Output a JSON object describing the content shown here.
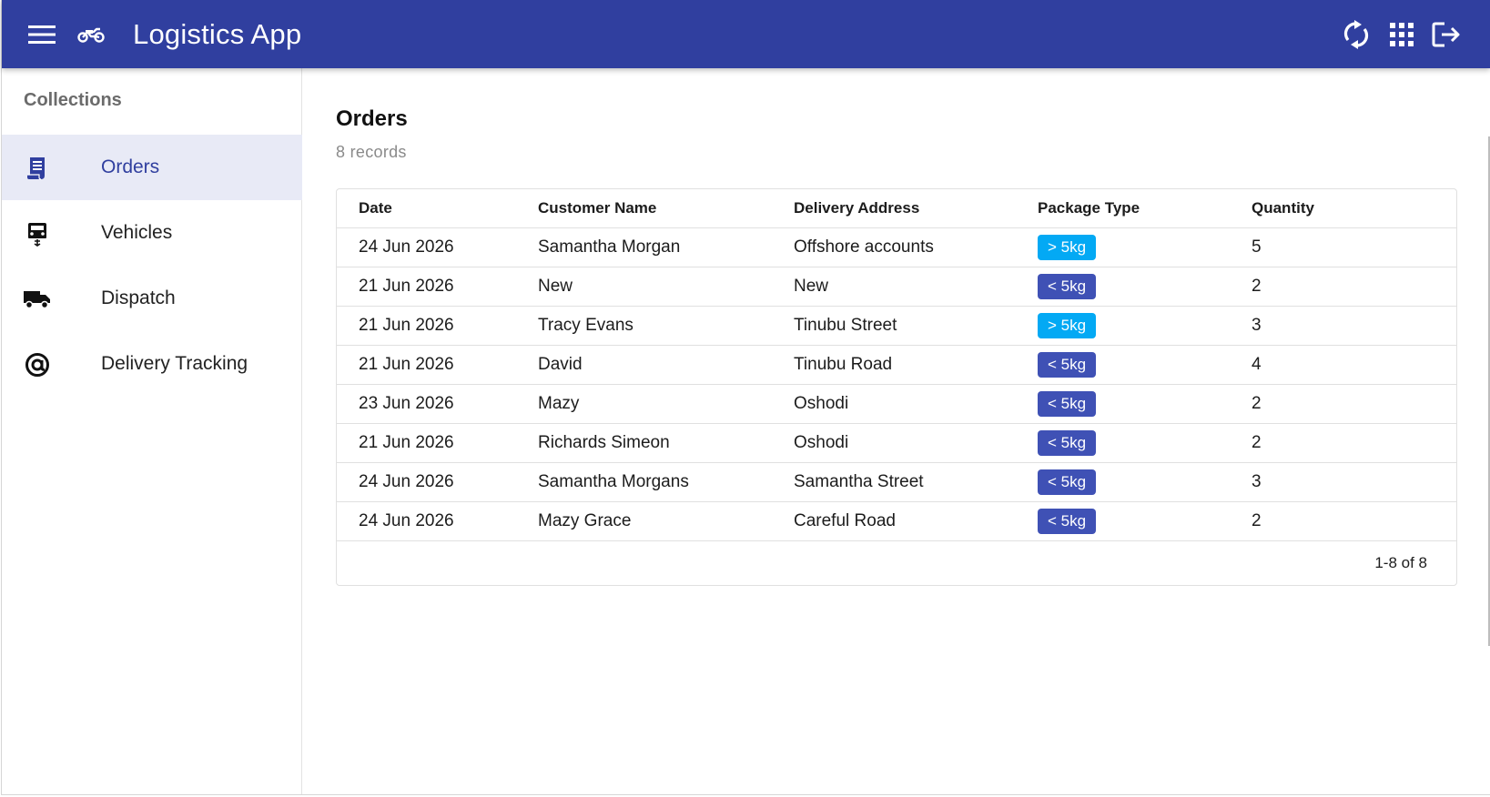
{
  "header": {
    "title": "Logistics App",
    "icons": [
      "menu-icon",
      "motorcycle-icon",
      "refresh-icon",
      "apps-icon",
      "logout-icon"
    ]
  },
  "sidebar": {
    "heading": "Collections",
    "items": [
      {
        "label": "Orders",
        "icon": "receipt-icon",
        "active": true
      },
      {
        "label": "Vehicles",
        "icon": "car-icon",
        "active": false
      },
      {
        "label": "Dispatch",
        "icon": "truck-icon",
        "active": false
      },
      {
        "label": "Delivery Tracking",
        "icon": "at-sign-icon",
        "active": false
      }
    ]
  },
  "main": {
    "title": "Orders",
    "record_count": "8 records",
    "columns": [
      "Date",
      "Customer Name",
      "Delivery Address",
      "Package Type",
      "Quantity"
    ],
    "rows": [
      {
        "date": "24 Jun 2026",
        "customer": "Samantha Morgan",
        "address": "Offshore accounts",
        "package": "> 5kg",
        "quantity": "5"
      },
      {
        "date": "21 Jun 2026",
        "customer": "New",
        "address": "New",
        "package": "< 5kg",
        "quantity": "2"
      },
      {
        "date": "21 Jun 2026",
        "customer": "Tracy Evans",
        "address": "Tinubu Street",
        "package": "> 5kg",
        "quantity": "3"
      },
      {
        "date": "21 Jun 2026",
        "customer": "David",
        "address": "Tinubu Road",
        "package": "< 5kg",
        "quantity": "4"
      },
      {
        "date": "23 Jun 2026",
        "customer": "Mazy",
        "address": "Oshodi",
        "package": "< 5kg",
        "quantity": "2"
      },
      {
        "date": "21 Jun 2026",
        "customer": "Richards Simeon",
        "address": "Oshodi",
        "package": "< 5kg",
        "quantity": "2"
      },
      {
        "date": "24 Jun 2026",
        "customer": "Samantha Morgans",
        "address": "Samantha Street",
        "package": "< 5kg",
        "quantity": "3"
      },
      {
        "date": "24 Jun 2026",
        "customer": "Mazy Grace",
        "address": "Careful Road",
        "package": "< 5kg",
        "quantity": "2"
      }
    ],
    "pagination": "1-8 of 8"
  },
  "colors": {
    "primary": "#303f9f",
    "chip_heavy": "#03a9f4",
    "chip_light": "#3f51b5",
    "active_nav_bg": "#e8eaf6"
  }
}
